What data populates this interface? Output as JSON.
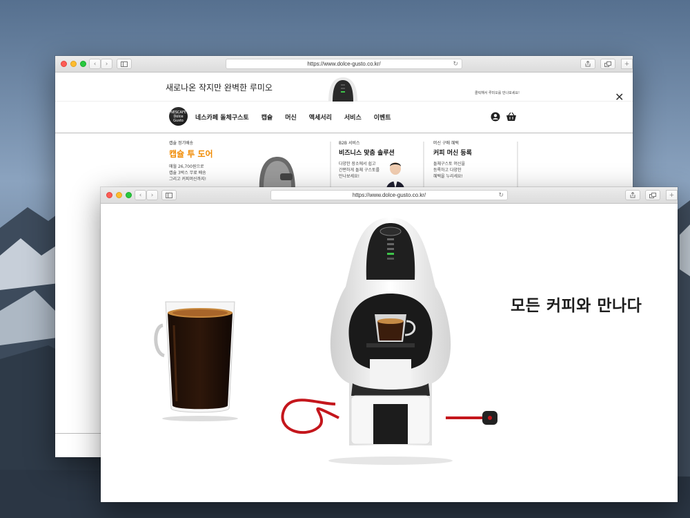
{
  "back_window": {
    "url": "https://www.dolce-gusto.co.kr/",
    "promo": {
      "title": "새로나온 작지만 완벽한 루미오",
      "right_text": "클릭해서 루미오를 만나보세요!"
    },
    "logo_text": "NESCAFÉ Dolce Gusto",
    "nav": [
      "네스카페 돌체구스토",
      "캡슐",
      "머신",
      "액세서리",
      "서비스",
      "이벤트"
    ],
    "cards": [
      {
        "label": "캡슐 정기배송",
        "title": "캡슐 투 도어",
        "desc": "매월 26,700원으로\n캡슐 3박스 무료 배송\n그리고 커피머신까지!"
      },
      {
        "label": "B2B 서비스",
        "title": "비즈니스 맞춤 솔루션",
        "desc": "다양한 장소에서 쉽고\n간편하게 돌체 구스토를\n만나보세요!"
      },
      {
        "label": "머신 구매 혜택",
        "title": "커피 머신 등록",
        "desc": "돌체구스토 머신을\n등록하고 다양한\n혜택을 누리세요!"
      }
    ]
  },
  "front_window": {
    "url": "https://www.dolce-gusto.co.kr/",
    "hero_text": "모든 커피와 만나다"
  },
  "icons": {
    "back": "chevron-left-icon",
    "forward": "chevron-right-icon",
    "sidebar": "sidebar-icon",
    "share": "share-icon",
    "tabs": "tabs-icon",
    "new_tab": "plus-icon",
    "reload": "reload-icon",
    "close": "close-icon",
    "account": "user-icon",
    "cart": "basket-icon"
  },
  "colors": {
    "accent_orange": "#f08a00",
    "traffic_red": "#fd5d56",
    "traffic_yellow": "#febc2e",
    "traffic_green": "#28c840"
  }
}
